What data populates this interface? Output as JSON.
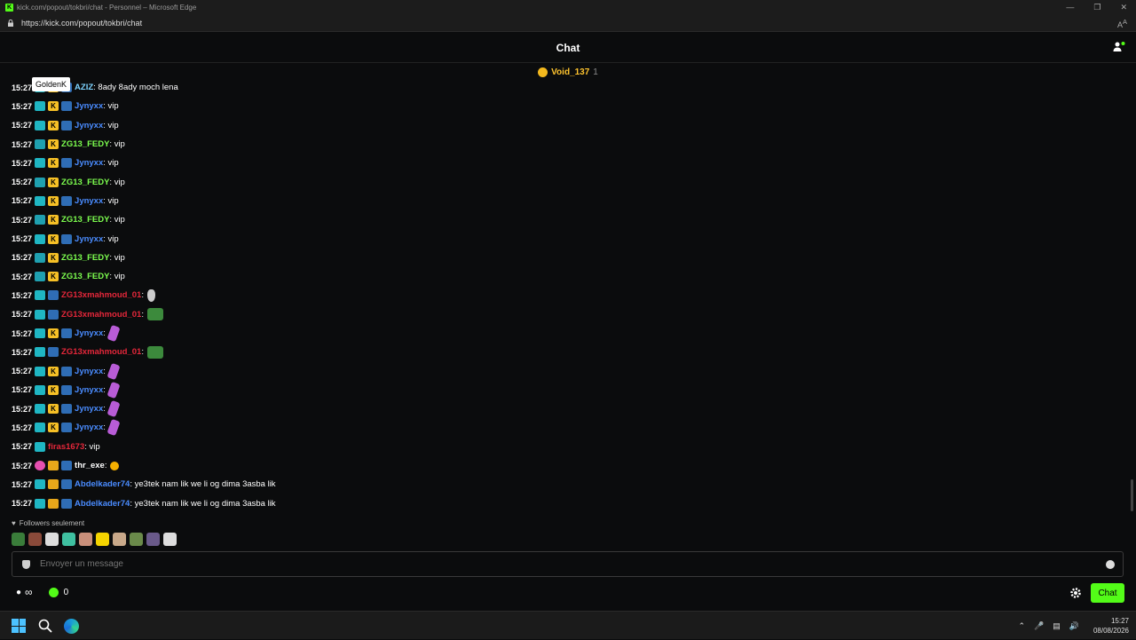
{
  "window": {
    "title": "kick.com/popout/tokbri/chat - Personnel – Microsoft Edge",
    "url": "https://kick.com/popout/tokbri/chat",
    "reader_label": "A"
  },
  "header": {
    "title": "Chat"
  },
  "pinned": {
    "user": "Void_137",
    "count": "1"
  },
  "tooltip": "GoldenK",
  "colors": {
    "accent": "#53fc18",
    "blue_user": "#4a8cff",
    "green_user": "#7dff4f",
    "red_user": "#e5273a",
    "white_user": "#ffffff"
  },
  "messages": [
    {
      "time": "15:27",
      "badges": [
        "sub",
        "k",
        "verified"
      ],
      "user": "AZIZ",
      "color": "#7dd3ff",
      "text": ": 8ady 8ady moch lena",
      "emote": ""
    },
    {
      "time": "15:27",
      "badges": [
        "sub",
        "k",
        "verified"
      ],
      "user": "Jynyxx",
      "color": "#4a8cff",
      "text": ": vip",
      "emote": ""
    },
    {
      "time": "15:27",
      "badges": [
        "sub",
        "k",
        "verified"
      ],
      "user": "Jynyxx",
      "color": "#4a8cff",
      "text": ": vip",
      "emote": ""
    },
    {
      "time": "15:27",
      "badges": [
        "sub2",
        "k"
      ],
      "user": "ZG13_FEDY",
      "color": "#7dff4f",
      "text": ": vip",
      "emote": ""
    },
    {
      "time": "15:27",
      "badges": [
        "sub",
        "k",
        "verified"
      ],
      "user": "Jynyxx",
      "color": "#4a8cff",
      "text": ": vip",
      "emote": ""
    },
    {
      "time": "15:27",
      "badges": [
        "sub2",
        "k"
      ],
      "user": "ZG13_FEDY",
      "color": "#7dff4f",
      "text": ": vip",
      "emote": ""
    },
    {
      "time": "15:27",
      "badges": [
        "sub",
        "k",
        "verified"
      ],
      "user": "Jynyxx",
      "color": "#4a8cff",
      "text": ": vip",
      "emote": ""
    },
    {
      "time": "15:27",
      "badges": [
        "sub2",
        "k"
      ],
      "user": "ZG13_FEDY",
      "color": "#7dff4f",
      "text": ": vip",
      "emote": ""
    },
    {
      "time": "15:27",
      "badges": [
        "sub",
        "k",
        "verified"
      ],
      "user": "Jynyxx",
      "color": "#4a8cff",
      "text": ": vip",
      "emote": ""
    },
    {
      "time": "15:27",
      "badges": [
        "sub2",
        "k"
      ],
      "user": "ZG13_FEDY",
      "color": "#7dff4f",
      "text": ": vip",
      "emote": ""
    },
    {
      "time": "15:27",
      "badges": [
        "sub2",
        "k"
      ],
      "user": "ZG13_FEDY",
      "color": "#7dff4f",
      "text": ": vip",
      "emote": ""
    },
    {
      "time": "15:27",
      "badges": [
        "sub",
        "verified"
      ],
      "user": "ZG13xmahmoud_01",
      "color": "#e5273a",
      "text": ":",
      "emote": "mic"
    },
    {
      "time": "15:27",
      "badges": [
        "sub",
        "verified"
      ],
      "user": "ZG13xmahmoud_01",
      "color": "#e5273a",
      "text": ":",
      "emote": "green"
    },
    {
      "time": "15:27",
      "badges": [
        "sub",
        "k",
        "verified"
      ],
      "user": "Jynyxx",
      "color": "#4a8cff",
      "text": ":",
      "emote": "purple"
    },
    {
      "time": "15:27",
      "badges": [
        "sub",
        "verified"
      ],
      "user": "ZG13xmahmoud_01",
      "color": "#e5273a",
      "text": ":",
      "emote": "green"
    },
    {
      "time": "15:27",
      "badges": [
        "sub",
        "k",
        "verified"
      ],
      "user": "Jynyxx",
      "color": "#4a8cff",
      "text": ":",
      "emote": "purple"
    },
    {
      "time": "15:27",
      "badges": [
        "sub",
        "k",
        "verified"
      ],
      "user": "Jynyxx",
      "color": "#4a8cff",
      "text": ":",
      "emote": "purple"
    },
    {
      "time": "15:27",
      "badges": [
        "sub",
        "k",
        "verified"
      ],
      "user": "Jynyxx",
      "color": "#4a8cff",
      "text": ":",
      "emote": "purple"
    },
    {
      "time": "15:27",
      "badges": [
        "sub",
        "k",
        "verified"
      ],
      "user": "Jynyxx",
      "color": "#4a8cff",
      "text": ":",
      "emote": "purple"
    },
    {
      "time": "15:27",
      "badges": [
        "sub"
      ],
      "user": "firas1673",
      "color": "#e5273a",
      "text": ": vip",
      "emote": ""
    },
    {
      "time": "15:27",
      "badges": [
        "pink",
        "crown",
        "verified"
      ],
      "user": "thr_exe",
      "color": "#ffffff",
      "text": ":",
      "emote": "yellow"
    },
    {
      "time": "15:27",
      "badges": [
        "sub",
        "crown",
        "verified"
      ],
      "user": "Abdelkader74",
      "color": "#4a8cff",
      "text": ": ye3tek nam lik we li og dima 3asba lik",
      "emote": ""
    },
    {
      "time": "15:27",
      "badges": [
        "sub",
        "crown",
        "verified"
      ],
      "user": "Abdelkader74",
      "color": "#4a8cff",
      "text": ": ye3tek nam lik we li og dima 3asba lik",
      "emote": ""
    }
  ],
  "followers_label": "Followers seulement",
  "emote_bar": [
    "#3a7d3a",
    "#8a4a3a",
    "#ddd",
    "#3fc0a0",
    "#c98f7a",
    "#f5d400",
    "#c9a98a",
    "#6a8a4a",
    "#6a5a8a",
    "#ddd"
  ],
  "input": {
    "placeholder": "Envoyer un message"
  },
  "bottom": {
    "infinity": "∞",
    "points": "0",
    "chat_button": "Chat"
  },
  "taskbar": {
    "time": "15:27",
    "date": "08/08/2026"
  }
}
